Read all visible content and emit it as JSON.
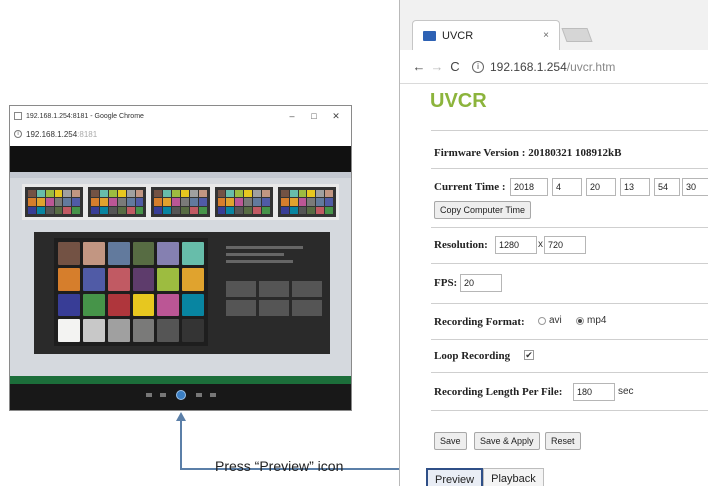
{
  "left_window": {
    "title": "192.168.1.254:8181 - Google Chrome",
    "controls": {
      "minimize": "–",
      "maximize": "□",
      "close": "✕"
    },
    "address_host": "192.168.1.254",
    "address_port": ":8181"
  },
  "callout": {
    "text": "Press “Preview” icon"
  },
  "browser": {
    "tab_title": "UVCR",
    "tab_close": "×",
    "back": "←",
    "forward": "→",
    "reload": "C",
    "url_host": "192.168.1.254",
    "url_path": "/uvcr.htm"
  },
  "page": {
    "brand": "UVCR",
    "firmware_label": "Firmware Version : 20180321 108912kB",
    "current_time": {
      "label": "Current Time :",
      "year": "2018",
      "month": "4",
      "day": "20",
      "hour": "13",
      "minute": "54",
      "second": "30",
      "copy_button": "Copy Computer Time"
    },
    "resolution": {
      "label": "Resolution:",
      "width": "1280",
      "sep": "x",
      "height": "720"
    },
    "fps": {
      "label": "FPS:",
      "value": "20"
    },
    "recording_format": {
      "label": "Recording Format:",
      "options": [
        "avi",
        "mp4"
      ],
      "selected": "mp4"
    },
    "loop_recording": {
      "label": "Loop Recording",
      "checked": true,
      "mark": "✔"
    },
    "recording_length": {
      "label": "Recording Length Per File:",
      "value": "180",
      "unit": "sec"
    },
    "buttons": {
      "save": "Save",
      "save_apply": "Save & Apply",
      "reset": "Reset"
    },
    "nav_tabs": {
      "preview": "Preview",
      "playback": "Playback"
    }
  },
  "colors": {
    "brand_green": "#8cb43c",
    "highlight_border": "#2f4f87",
    "arrow": "#5b7fa8"
  }
}
